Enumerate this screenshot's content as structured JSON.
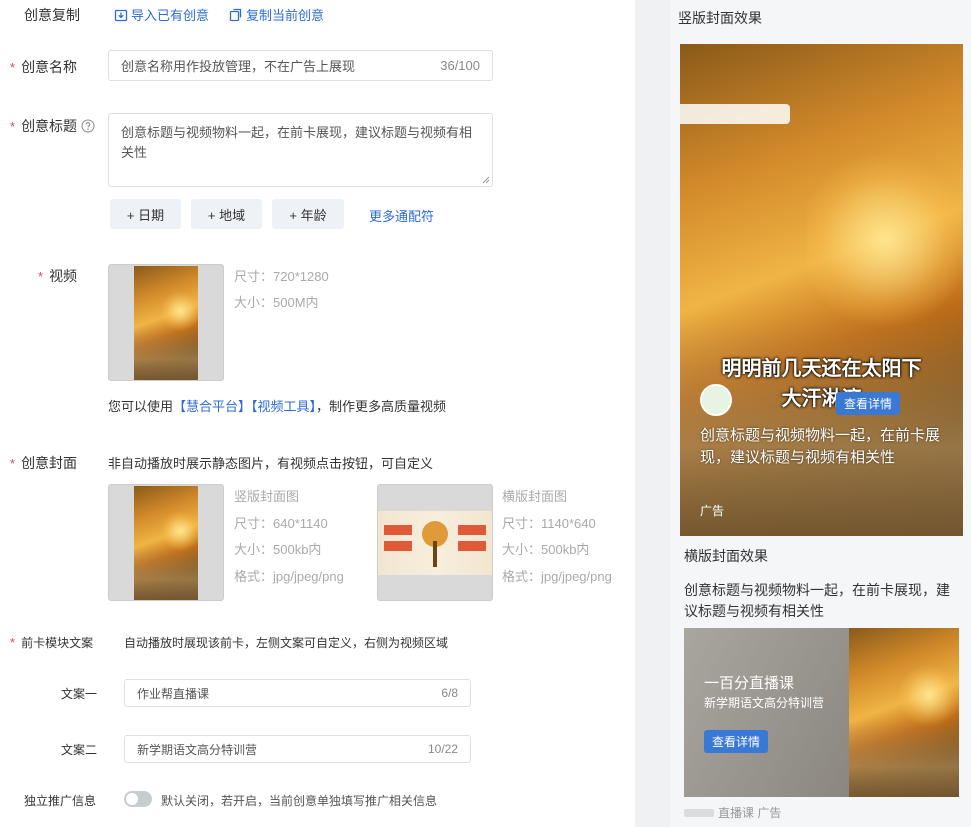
{
  "copy_row": {
    "label": "创意复制",
    "import_link": "导入已有创意",
    "copy_link": "复制当前创意"
  },
  "name_row": {
    "required": "*",
    "label": "创意名称",
    "value": "创意名称用作投放管理，不在广告上展现",
    "count": "36/100"
  },
  "title_row": {
    "required": "*",
    "label": "创意标题",
    "value": "创意标题与视频物料一起，在前卡展现，建议标题与视频有相关性",
    "tags": [
      "+ 日期",
      "+ 地域",
      "+ 年龄"
    ],
    "more_link": "更多通配符"
  },
  "video_row": {
    "required": "*",
    "label": "视频",
    "size_spec": "尺寸：720*1280",
    "file_spec": "大小：500M内",
    "hint_prefix": "您可以使用",
    "hint_link1": "【慧合平台】",
    "hint_link2": "【视频工具】",
    "hint_suffix": "，制作更多高质量视频"
  },
  "cover_row": {
    "required": "*",
    "label": "创意封面",
    "desc": "非自动播放时展示静态图片，有视频点击按钮，可自定义",
    "vertical": {
      "title": "竖版封面图",
      "size": "尺寸：640*1140",
      "file": "大小：500kb内",
      "format": "格式：jpg/jpeg/png"
    },
    "horizontal": {
      "title": "横版封面图",
      "size": "尺寸：1140*640",
      "file": "大小：500kb内",
      "format": "格式：jpg/jpeg/png"
    }
  },
  "front_card_row": {
    "required": "*",
    "label": "前卡模块文案",
    "desc": "自动播放时展现该前卡，左侧文案可自定义，右侧为视频区域"
  },
  "copy1": {
    "label": "文案一",
    "value": "作业帮直播课",
    "count": "6/8"
  },
  "copy2": {
    "label": "文案二",
    "value": "新学期语文高分特训营",
    "count": "10/22"
  },
  "promo_row": {
    "label": "独立推广信息",
    "toggle_on": false,
    "desc": "默认关闭，若开启，当前创意单独填写推广相关信息"
  },
  "preview": {
    "vertical_title": "竖版封面效果",
    "video_caption_line1": "明明前几天还在太阳下",
    "video_caption_line2": "大汗淋漓",
    "cta": "查看详情",
    "ad_text": "创意标题与视频物料一起，在前卡展现，建议标题与视频有相关性",
    "ad_badge": "广告",
    "horizontal_title": "横版封面效果",
    "horizontal_text": "创意标题与视频物料一起，在前卡展现，建议标题与视频有相关性",
    "card_line1": "一百分直播课",
    "card_line2": "新学期语文高分特训营",
    "card_cta": "查看详情",
    "footer_text": "直播课 广告"
  },
  "colors": {
    "link": "#2d6bd6",
    "required": "#e5484d",
    "cta": "#3a78d6"
  }
}
